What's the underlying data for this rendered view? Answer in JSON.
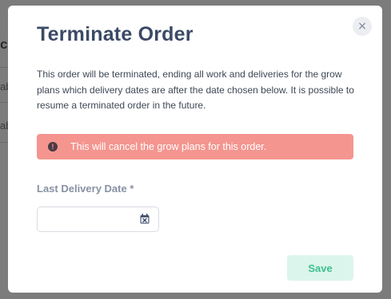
{
  "modal": {
    "title": "Terminate Order",
    "close_label": "×",
    "description": "This order will be terminated, ending all work and deliveries for the grow plans which delivery dates are after the date chosen below. It is possible to resume a terminated order in the future.",
    "alert": {
      "icon": "alert-circle-icon",
      "text": "This will cancel the grow plans for this order."
    },
    "last_delivery_date": {
      "label": "Last Delivery Date *",
      "value": "",
      "icon": "calendar-icon"
    },
    "save_label": "Save"
  },
  "background": {
    "fragments": [
      "co",
      "ab",
      "ab"
    ]
  },
  "colors": {
    "title": "#3b4a66",
    "alert_bg": "#f4958f",
    "save_bg": "#dcf5ec",
    "save_text": "#3fbf8f"
  }
}
